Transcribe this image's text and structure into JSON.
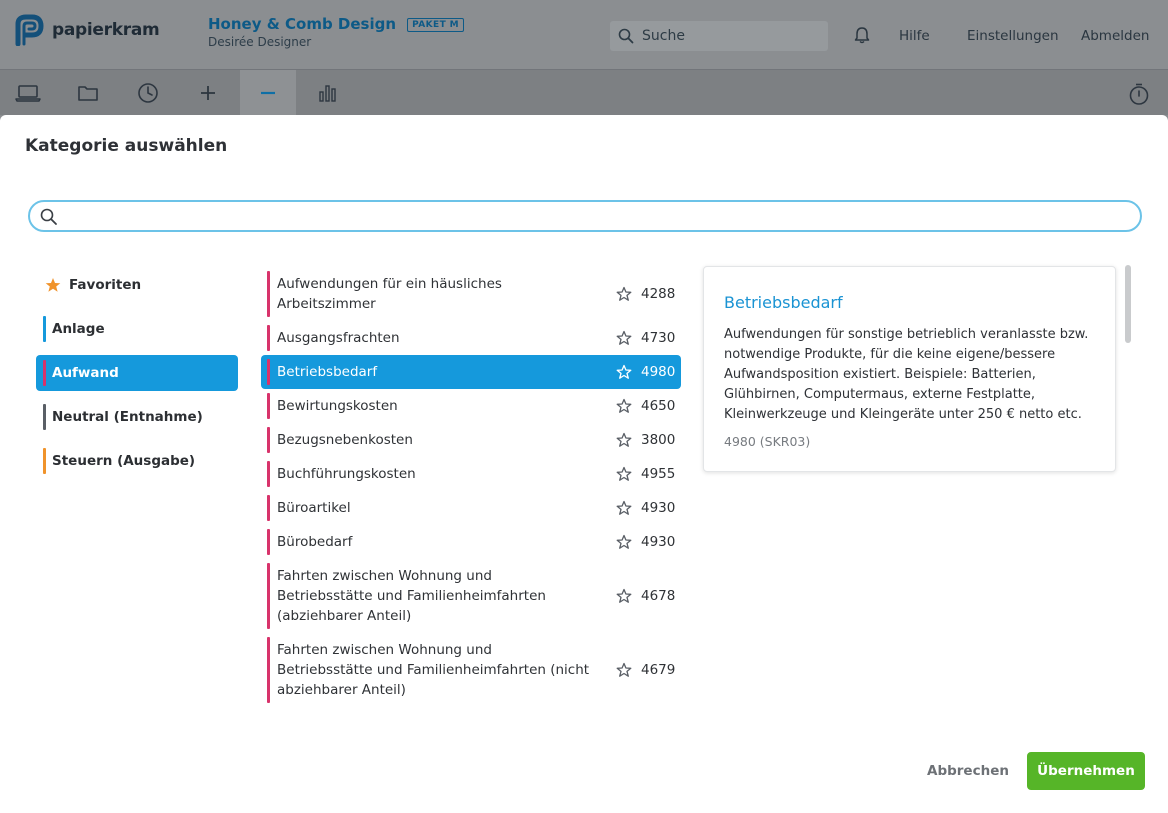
{
  "header": {
    "brand": "papierkram",
    "company_name": "Honey & Comb Design",
    "plan_badge": "PAKET M",
    "user_name": "Desirée Designer",
    "search_placeholder": "Suche",
    "nav": [
      "Hilfe",
      "Einstellungen",
      "Abmelden"
    ]
  },
  "toolbar": {
    "icons": [
      "laptop-icon",
      "folder-icon",
      "clock-icon",
      "plus-icon",
      "minus-icon",
      "bar-chart-icon"
    ],
    "active": "minus-icon",
    "right_icon": "stopwatch-icon"
  },
  "modal": {
    "title": "Kategorie auswählen",
    "search_value": "",
    "categories": [
      {
        "label": "Favoriten",
        "icon": "star-filled-icon",
        "color": "#f0932b"
      },
      {
        "label": "Anlage",
        "color": "#1599dc"
      },
      {
        "label": "Aufwand",
        "color": "#d8336b",
        "selected": true
      },
      {
        "label": "Neutral (Entnahme)",
        "color": "#5a5f66"
      },
      {
        "label": "Steuern (Ausgabe)",
        "color": "#f0932b"
      }
    ],
    "items": [
      {
        "label": "Aufwendungen für ein häusliches Arbeitszimmer",
        "number": "4288"
      },
      {
        "label": "Ausgangsfrachten",
        "number": "4730"
      },
      {
        "label": "Betriebsbedarf",
        "number": "4980",
        "selected": true
      },
      {
        "label": "Bewirtungskosten",
        "number": "4650"
      },
      {
        "label": "Bezugsnebenkosten",
        "number": "3800"
      },
      {
        "label": "Buchführungskosten",
        "number": "4955"
      },
      {
        "label": "Büroartikel",
        "number": "4930"
      },
      {
        "label": "Bürobedarf",
        "number": "4930"
      },
      {
        "label": "Fahrten zwischen Wohnung und Betriebsstätte und Familienheimfahrten (abziehbarer Anteil)",
        "number": "4678"
      },
      {
        "label": "Fahrten zwischen Wohnung und Betriebsstätte und Familienheimfahrten (nicht abziehbarer Anteil)",
        "number": "4679"
      }
    ],
    "detail": {
      "title": "Betriebsbedarf",
      "description": "Aufwendungen für sonstige betrieblich veranlasste bzw. notwendige Produkte, für die keine eigene/bessere Aufwandsposition existiert. Beispiele: Batterien, Glühbirnen, Computermaus, externe Festplatte, Kleinwerkzeuge und Kleingeräte unter 250 € netto etc.",
      "code": "4980 (SKR03)"
    },
    "cancel_label": "Abbrechen",
    "confirm_label": "Übernehmen"
  },
  "colors": {
    "accent": "#1599dc",
    "expense": "#d8336b",
    "confirm": "#56b528"
  }
}
